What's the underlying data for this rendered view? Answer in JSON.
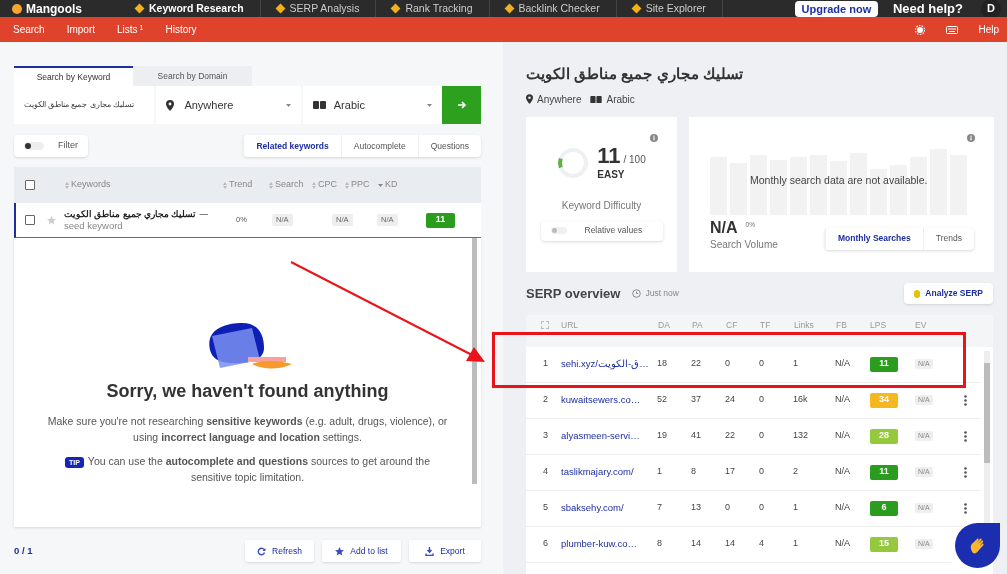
{
  "top_nav": {
    "logo": "Mangools",
    "items": [
      {
        "label": "Keyword Research",
        "selected": true
      },
      {
        "label": "SERP Analysis",
        "selected": false
      },
      {
        "label": "Rank Tracking",
        "selected": false
      },
      {
        "label": "Backlink Checker",
        "selected": false
      },
      {
        "label": "Site Explorer",
        "selected": false
      }
    ],
    "upgrade_button": "Upgrade now",
    "help_text": "Need help?",
    "avatar": "D"
  },
  "sub_nav": {
    "items": [
      {
        "label": "Search"
      },
      {
        "label": "Import"
      },
      {
        "label": "Lists",
        "badge": "1"
      },
      {
        "label": "History"
      }
    ],
    "help": "Help"
  },
  "search": {
    "tabs": [
      {
        "label": "Search by Keyword",
        "selected": true
      },
      {
        "label": "Search by Domain",
        "selected": false
      }
    ],
    "keyword": "تسليك مجارى جميع مناطق الكويت",
    "location": "Anywhere",
    "language": "Arabic"
  },
  "filter": {
    "label": "Filter",
    "on": false
  },
  "source_tabs": [
    {
      "label": "Related keywords",
      "selected": true
    },
    {
      "label": "Autocomplete",
      "selected": false
    },
    {
      "label": "Questions",
      "selected": false
    }
  ],
  "keywords_table": {
    "columns": [
      "Keywords",
      "Trend",
      "Search",
      "CPC",
      "PPC",
      "KD"
    ],
    "rows": [
      {
        "keyword": "تسليك مجاري جميع مناطق الكويت",
        "separator": "—",
        "note": "seed keyword",
        "checked": false,
        "trend": "0%",
        "search": "N/A",
        "cpc": "N/A",
        "ppc": "N/A",
        "kd": "11",
        "color": "#2a9d1f"
      }
    ],
    "all_checked": false
  },
  "empty_state": {
    "title": "Sorry, we haven't found anything",
    "message": "Make sure you're not researching **sensitive keywords** (e.g. adult, drugs, violence), or using **incorrect language and location** settings.",
    "tip_badge": "TIP",
    "tip": "You can use the **autocomplete and questions** sources to get around the sensitive topic limitation."
  },
  "footer": {
    "count": "0 / 1",
    "buttons": [
      "Refresh",
      "Add to list",
      "Export"
    ]
  },
  "detail": {
    "title": "تسليك مجاري جميع مناطق الكويت",
    "location": "Anywhere",
    "language": "Arabic",
    "difficulty": {
      "value": "11",
      "max": "/ 100",
      "rating": "EASY",
      "label": "Keyword Difficulty",
      "level": 0.11,
      "toggle_label": "Relative values",
      "toggle_on": false
    },
    "volume": {
      "message": "Monthly search data are not available.",
      "value": "N/A",
      "change": "0%",
      "label": "Search Volume",
      "tabs": [
        {
          "label": "Monthly Searches",
          "selected": true
        },
        {
          "label": "Trends",
          "selected": false
        }
      ]
    }
  },
  "serp": {
    "title": "SERP overview",
    "time": "Just now",
    "analyze_button": "Analyze SERP",
    "columns": [
      "URL",
      "DA",
      "PA",
      "CF",
      "TF",
      "Links",
      "FB",
      "LPS",
      "EV"
    ],
    "rows": [
      {
        "rank": "1",
        "url": "sehi.xyz/ق-الكويت…",
        "da": "18",
        "pa": "22",
        "cf": "0",
        "tf": "0",
        "links": "1",
        "fb": "N/A",
        "lps": "11",
        "color": "#2a9d1f",
        "ev": "N/A",
        "menu": false
      },
      {
        "rank": "2",
        "url": "kuwaitsewers.co…",
        "da": "52",
        "pa": "37",
        "cf": "24",
        "tf": "0",
        "links": "16k",
        "fb": "N/A",
        "lps": "34",
        "color": "#f5b820",
        "ev": "N/A",
        "menu": true
      },
      {
        "rank": "3",
        "url": "alyasmeen-servi…",
        "da": "19",
        "pa": "41",
        "cf": "22",
        "tf": "0",
        "links": "132",
        "fb": "N/A",
        "lps": "28",
        "color": "#95c93d",
        "ev": "N/A",
        "menu": true
      },
      {
        "rank": "4",
        "url": "taslikmajary.com/",
        "da": "1",
        "pa": "8",
        "cf": "17",
        "tf": "0",
        "links": "2",
        "fb": "N/A",
        "lps": "11",
        "color": "#2a9d1f",
        "ev": "N/A",
        "menu": true
      },
      {
        "rank": "5",
        "url": "sbaksehy.com/",
        "da": "7",
        "pa": "13",
        "cf": "0",
        "tf": "0",
        "links": "1",
        "fb": "N/A",
        "lps": "6",
        "color": "#2a9d1f",
        "ev": "N/A",
        "menu": true
      },
      {
        "rank": "6",
        "url": "plumber-kuw.co…",
        "da": "8",
        "pa": "14",
        "cf": "14",
        "tf": "4",
        "links": "1",
        "fb": "N/A",
        "lps": "15",
        "color": "#95c93d",
        "ev": "N/A",
        "menu": false
      }
    ]
  }
}
